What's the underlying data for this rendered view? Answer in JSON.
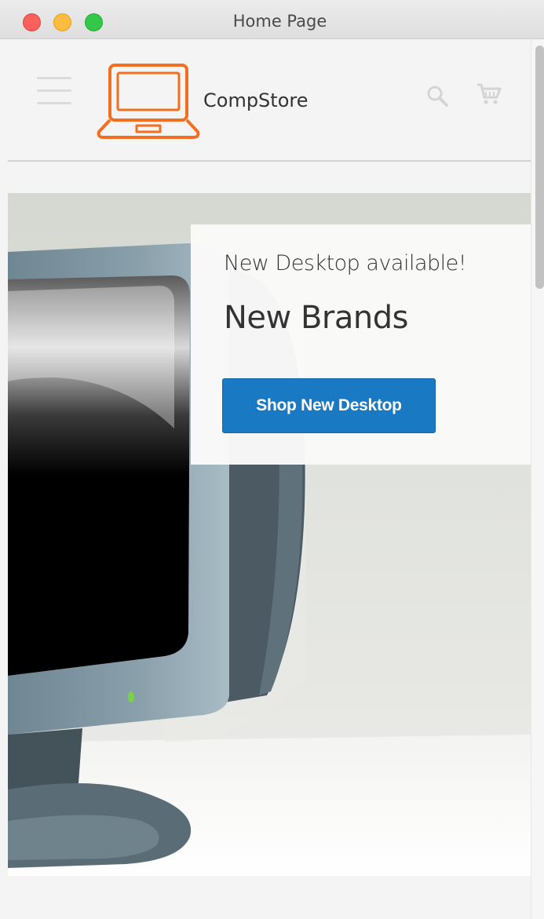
{
  "window": {
    "title": "Home Page"
  },
  "header": {
    "brand": "CompStore",
    "menu_icon": "hamburger-icon",
    "search_icon": "search-icon",
    "cart_icon": "cart-icon",
    "logo_color": "#f26f21"
  },
  "hero": {
    "subtitle": "New Desktop available!",
    "title": "New Brands",
    "cta_label": "Shop New Desktop",
    "cta_color": "#1979c3"
  }
}
